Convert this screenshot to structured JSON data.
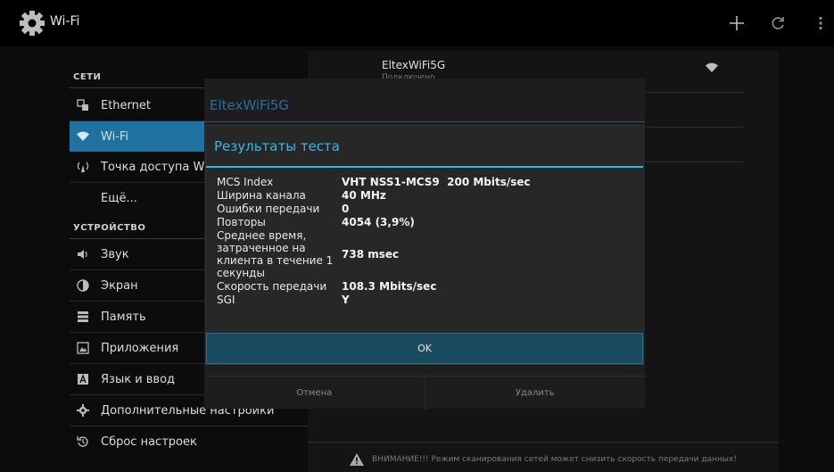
{
  "app": {
    "title": "Wi-Fi"
  },
  "sidebar": {
    "sections": [
      {
        "title": "СЕТИ",
        "items": [
          {
            "icon": "ethernet-icon",
            "label": "Ethernet"
          },
          {
            "icon": "wifi-icon",
            "label": "Wi-Fi",
            "selected": true
          },
          {
            "icon": "hotspot-icon",
            "label": "Точка доступа Wi-Fi"
          },
          {
            "icon": "",
            "label": "Ещё..."
          }
        ]
      },
      {
        "title": "УСТРОЙСТВО",
        "items": [
          {
            "icon": "sound-icon",
            "label": "Звук"
          },
          {
            "icon": "display-icon",
            "label": "Экран"
          },
          {
            "icon": "storage-icon",
            "label": "Память"
          },
          {
            "icon": "apps-icon",
            "label": "Приложения"
          },
          {
            "icon": "language-icon",
            "label": "Язык и ввод"
          },
          {
            "icon": "gear-icon",
            "label": "Дополнительные настройки"
          },
          {
            "icon": "reset-icon",
            "label": "Сброс настроек"
          }
        ]
      }
    ]
  },
  "networks": [
    {
      "name": "EltexWiFi5G",
      "status": "Подключено"
    }
  ],
  "warning": {
    "text": "ВНИМАНИЕ!!! Режим сканирования сетей может снизить скорость передачи данных!"
  },
  "back_dialog": {
    "title": "EltexWiFi5G",
    "cancel_label": "Отмена",
    "delete_label": "Удалить"
  },
  "dialog": {
    "title": "Результаты теста",
    "rows": [
      {
        "key": "MCS Index",
        "value": "VHT NSS1-MCS9  200 Mbits/sec"
      },
      {
        "key": "Ширина канала",
        "value": "40 MHz"
      },
      {
        "key": "Ошибки передачи",
        "value": "0"
      },
      {
        "key": "Повторы",
        "value": "4054 (3,9%)"
      },
      {
        "key": "Среднее время, затраченное на клиента в течение 1 секунды",
        "value": "738 msec"
      },
      {
        "key": "Скорость передачи",
        "value": "108.3 Mbits/sec"
      },
      {
        "key": "SGI",
        "value": "Y"
      }
    ],
    "ok_label": "OK"
  },
  "colors": {
    "accent": "#33b5e5",
    "selected": "#1f72a0",
    "ok_button": "#1a4a5e"
  }
}
